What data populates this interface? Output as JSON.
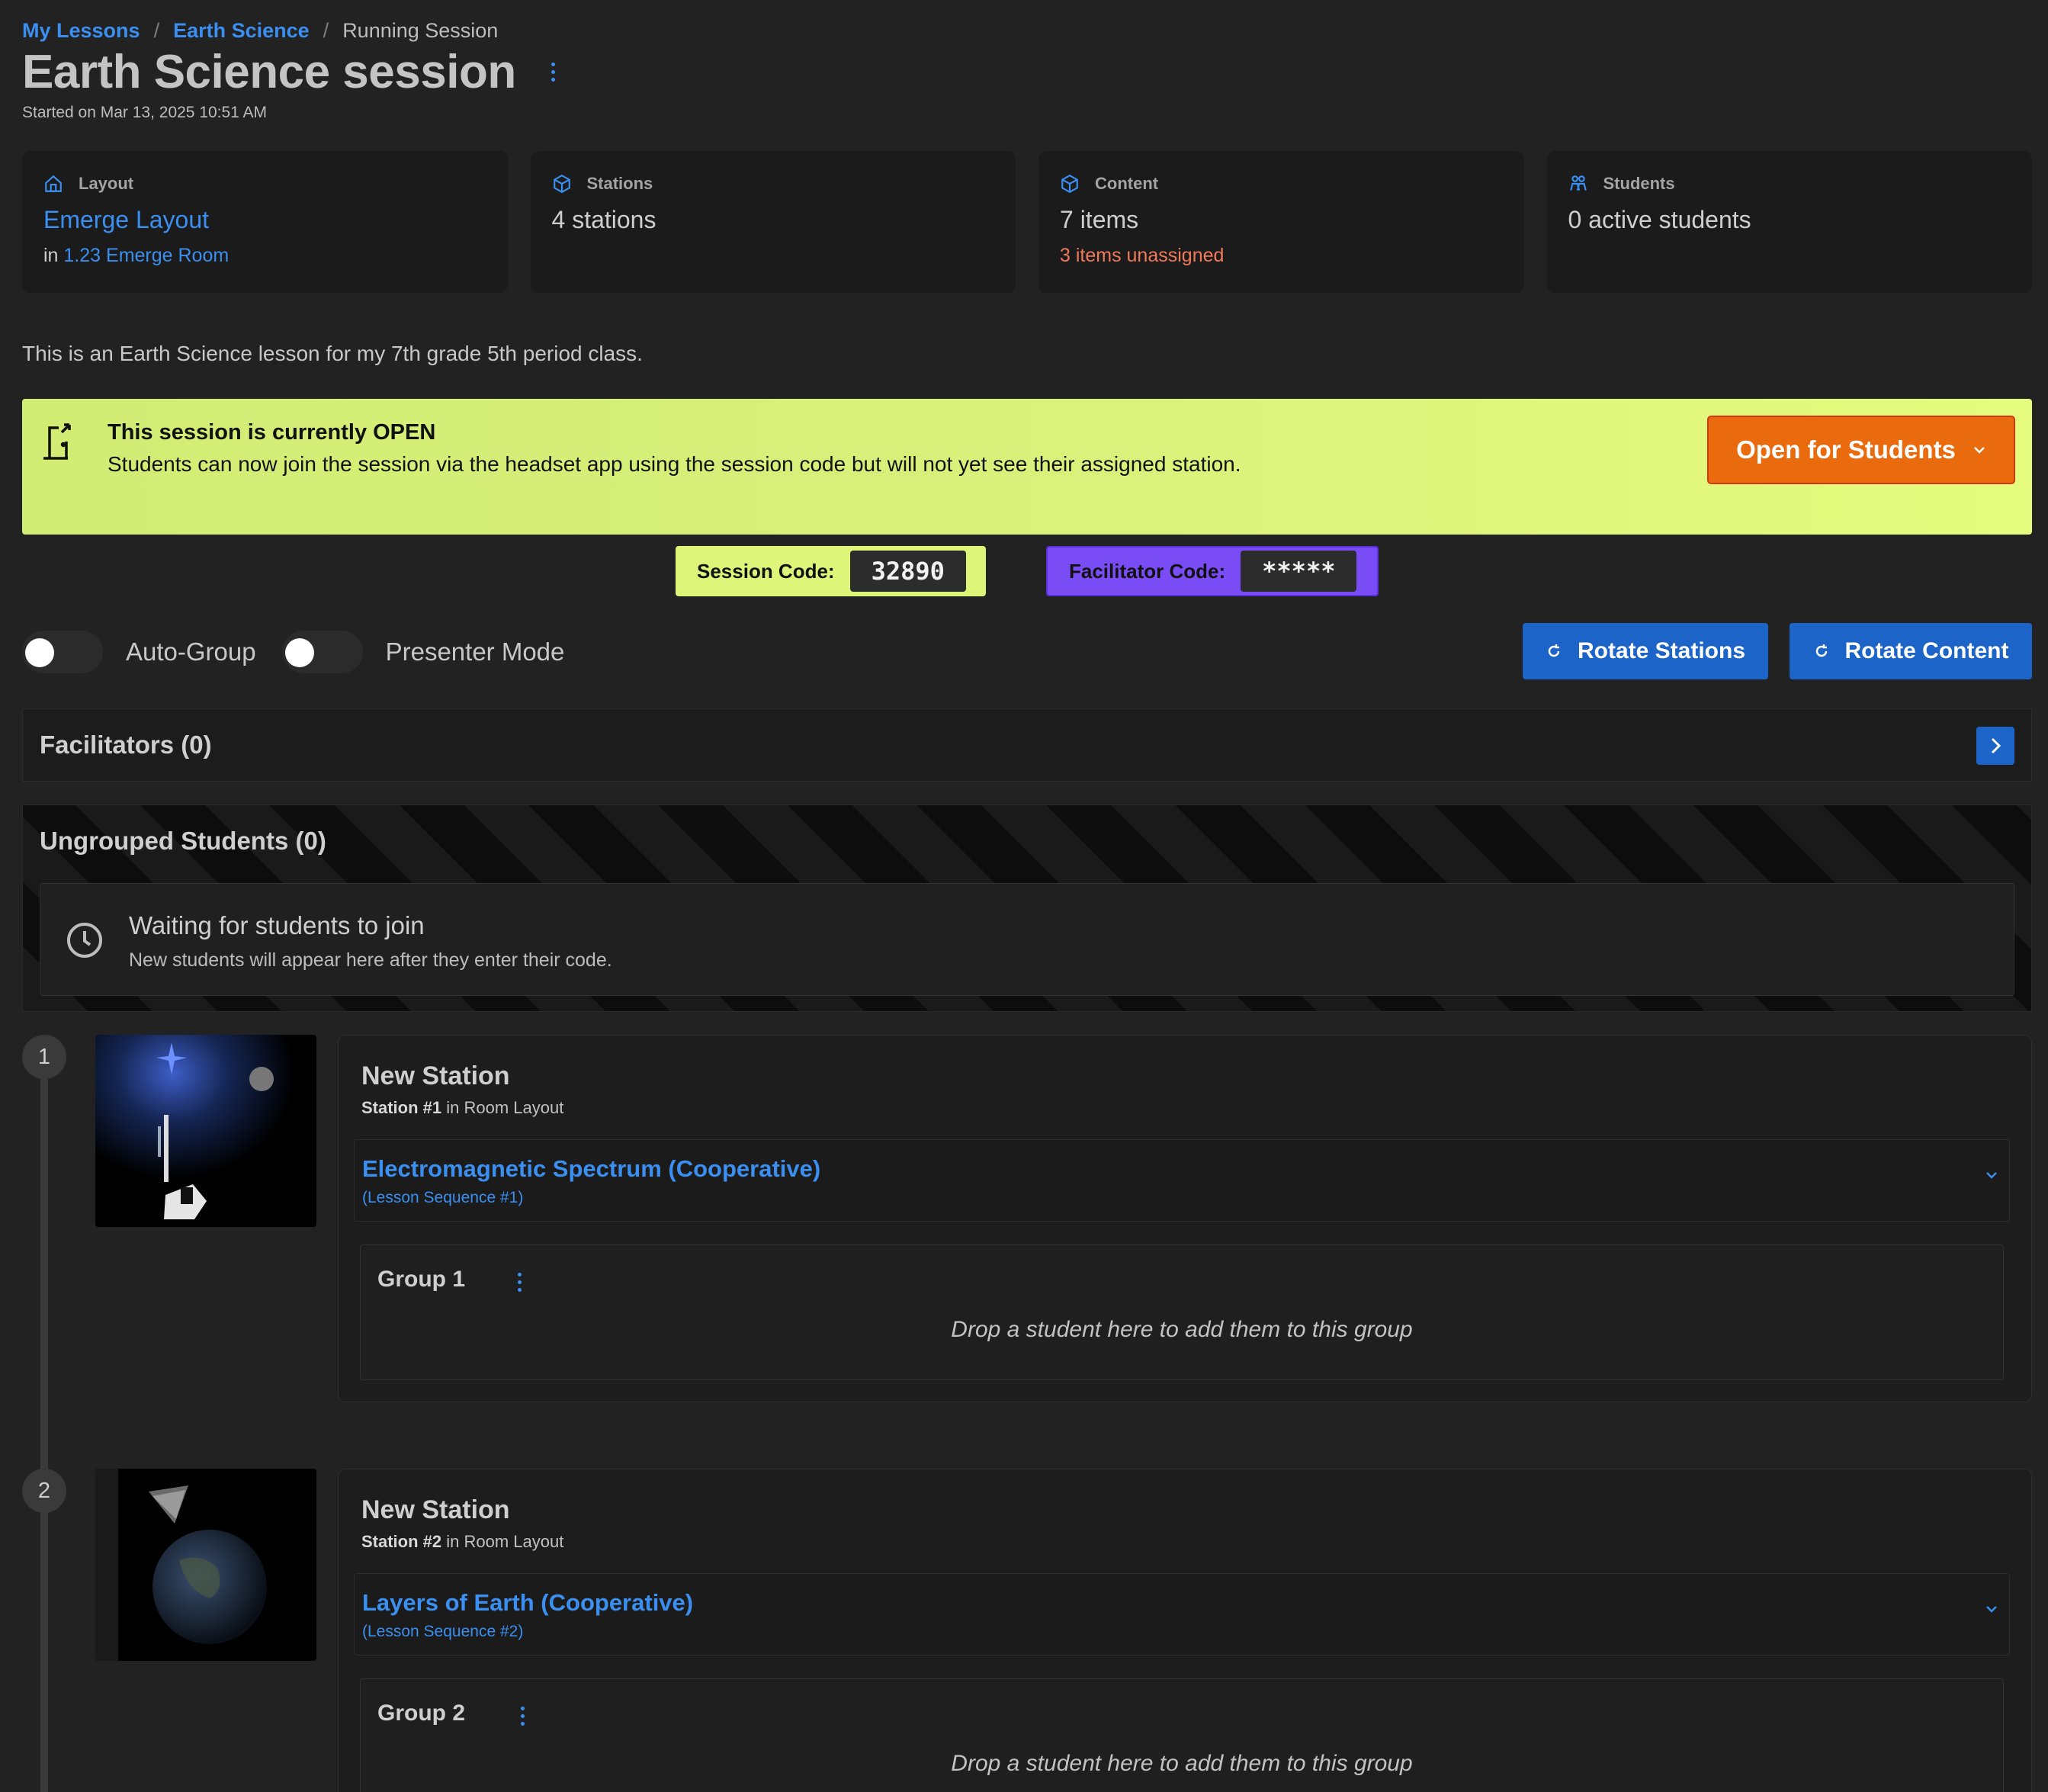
{
  "breadcrumb": {
    "items": [
      "My Lessons",
      "Earth Science"
    ],
    "separator": "/",
    "current": "Running Session"
  },
  "header": {
    "title": "Earth Science session",
    "started": "Started on Mar 13, 2025 10:51 AM"
  },
  "cards": {
    "layout": {
      "label": "Layout",
      "icon": "home-icon",
      "value": "Emerge Layout",
      "in_prefix": "in",
      "room": "1.23 Emerge Room"
    },
    "stations": {
      "label": "Stations",
      "icon": "cube-icon",
      "value": "4 stations"
    },
    "content": {
      "label": "Content",
      "icon": "cube-icon",
      "value": "7 items",
      "warning": "3 items unassigned"
    },
    "students": {
      "label": "Students",
      "icon": "users-icon",
      "value": "0 active students"
    }
  },
  "description": "This is an Earth Science lesson for my 7th grade 5th period class.",
  "banner": {
    "icon": "door-exit-icon",
    "title": "This session is currently OPEN",
    "body": "Students can now join the session via the headset app using the session code but will not yet see their assigned station.",
    "button": "Open for Students"
  },
  "codes": {
    "session_label": "Session Code:",
    "session_value": "32890",
    "facilitator_label": "Facilitator Code:",
    "facilitator_value": "*****"
  },
  "toggles": {
    "auto_group": {
      "label": "Auto-Group",
      "on": false
    },
    "presenter": {
      "label": "Presenter Mode",
      "on": false
    }
  },
  "actions": {
    "rotate_stations": "Rotate Stations",
    "rotate_content": "Rotate Content"
  },
  "facilitators": {
    "title": "Facilitators (0)"
  },
  "ungrouped": {
    "title": "Ungrouped Students (0)",
    "waiting_title": "Waiting for students to join",
    "waiting_sub": "New students will appear here after they enter their code."
  },
  "stations": [
    {
      "step": "1",
      "name": "New Station",
      "number_label": "Station #1",
      "layout_suffix": "in Room Layout",
      "content_title": "Electromagnetic Spectrum (Cooperative)",
      "content_sub": "(Lesson Sequence #1)",
      "group": "Group 1",
      "drop_hint": "Drop a student here to add them to this group"
    },
    {
      "step": "2",
      "name": "New Station",
      "number_label": "Station #2",
      "layout_suffix": "in Room Layout",
      "content_title": "Layers of Earth (Cooperative)",
      "content_sub": "(Lesson Sequence #2)",
      "group": "Group 2",
      "drop_hint": "Drop a student here to add them to this group"
    }
  ],
  "colors": {
    "accent": "#3b8ff0",
    "button_blue": "#1c64c8",
    "open_orange": "#ea6a0e",
    "banner_green": "#daf17b",
    "facilitator_purple": "#7a4cf5",
    "warning": "#f07a5a"
  }
}
